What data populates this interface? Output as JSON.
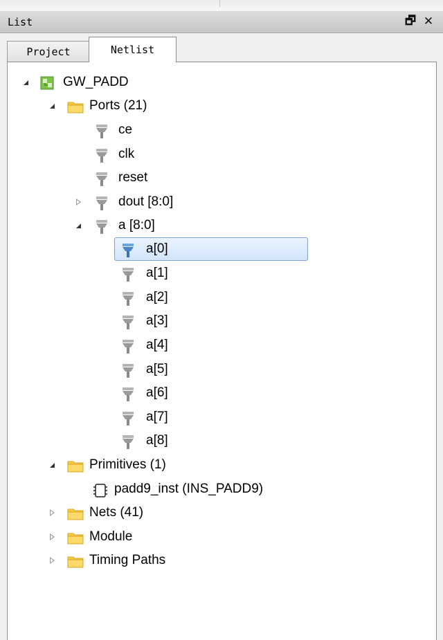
{
  "panel": {
    "title": "List",
    "float_icon": "restore-window-icon",
    "close_icon": "close-icon",
    "float_glyph": "🗗",
    "close_glyph": "✕"
  },
  "tabs": [
    {
      "label": "Project",
      "active": false
    },
    {
      "label": "Netlist",
      "active": true
    }
  ],
  "tree": {
    "root": {
      "label": "GW_PADD",
      "icon": "design-icon",
      "expanded": true
    },
    "ports": {
      "label": "Ports (21)",
      "icon": "folder-icon",
      "expanded": true,
      "items": [
        {
          "label": "ce",
          "icon": "port-icon"
        },
        {
          "label": "clk",
          "icon": "port-icon"
        },
        {
          "label": "reset",
          "icon": "port-icon"
        },
        {
          "label": "dout [8:0]",
          "icon": "port-icon",
          "expanded": false
        },
        {
          "label": "a [8:0]",
          "icon": "port-icon",
          "expanded": true
        }
      ],
      "a_bits": [
        {
          "label": "a[0]",
          "selected": true
        },
        {
          "label": "a[1]"
        },
        {
          "label": "a[2]"
        },
        {
          "label": "a[3]"
        },
        {
          "label": "a[4]"
        },
        {
          "label": "a[5]"
        },
        {
          "label": "a[6]"
        },
        {
          "label": "a[7]"
        },
        {
          "label": "a[8]"
        }
      ]
    },
    "primitives": {
      "label": "Primitives (1)",
      "icon": "folder-icon",
      "expanded": true,
      "items": [
        {
          "label": "padd9_inst  (INS_PADD9)",
          "icon": "primitive-icon"
        }
      ]
    },
    "nets": {
      "label": "Nets (41)",
      "icon": "folder-icon",
      "expanded": false
    },
    "module": {
      "label": "Module",
      "icon": "folder-icon",
      "expanded": false
    },
    "timing": {
      "label": "Timing Paths",
      "icon": "folder-icon",
      "expanded": false
    }
  },
  "colors": {
    "folder": "#f7c948",
    "port": "#9a9a9a",
    "port_selected": "#4a86c5",
    "selection": "#d1e5fb",
    "design": "#6cbb3c"
  }
}
